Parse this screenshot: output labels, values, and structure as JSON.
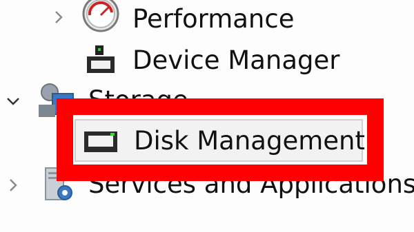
{
  "tree": {
    "items": [
      {
        "label": "Performance",
        "icon": "performance-gauge-icon",
        "expander": "chevron-right-icon"
      },
      {
        "label": "Device Manager",
        "icon": "device-manager-icon"
      },
      {
        "label": "Storage",
        "icon": "storage-icon",
        "expander": "chevron-down-icon"
      },
      {
        "label": "Disk Management",
        "icon": "disk-drive-icon",
        "selected": true
      },
      {
        "label": "Services and Applications",
        "icon": "services-applications-icon",
        "expander": "chevron-right-icon"
      }
    ]
  },
  "highlight": {
    "color": "#ff0000"
  }
}
